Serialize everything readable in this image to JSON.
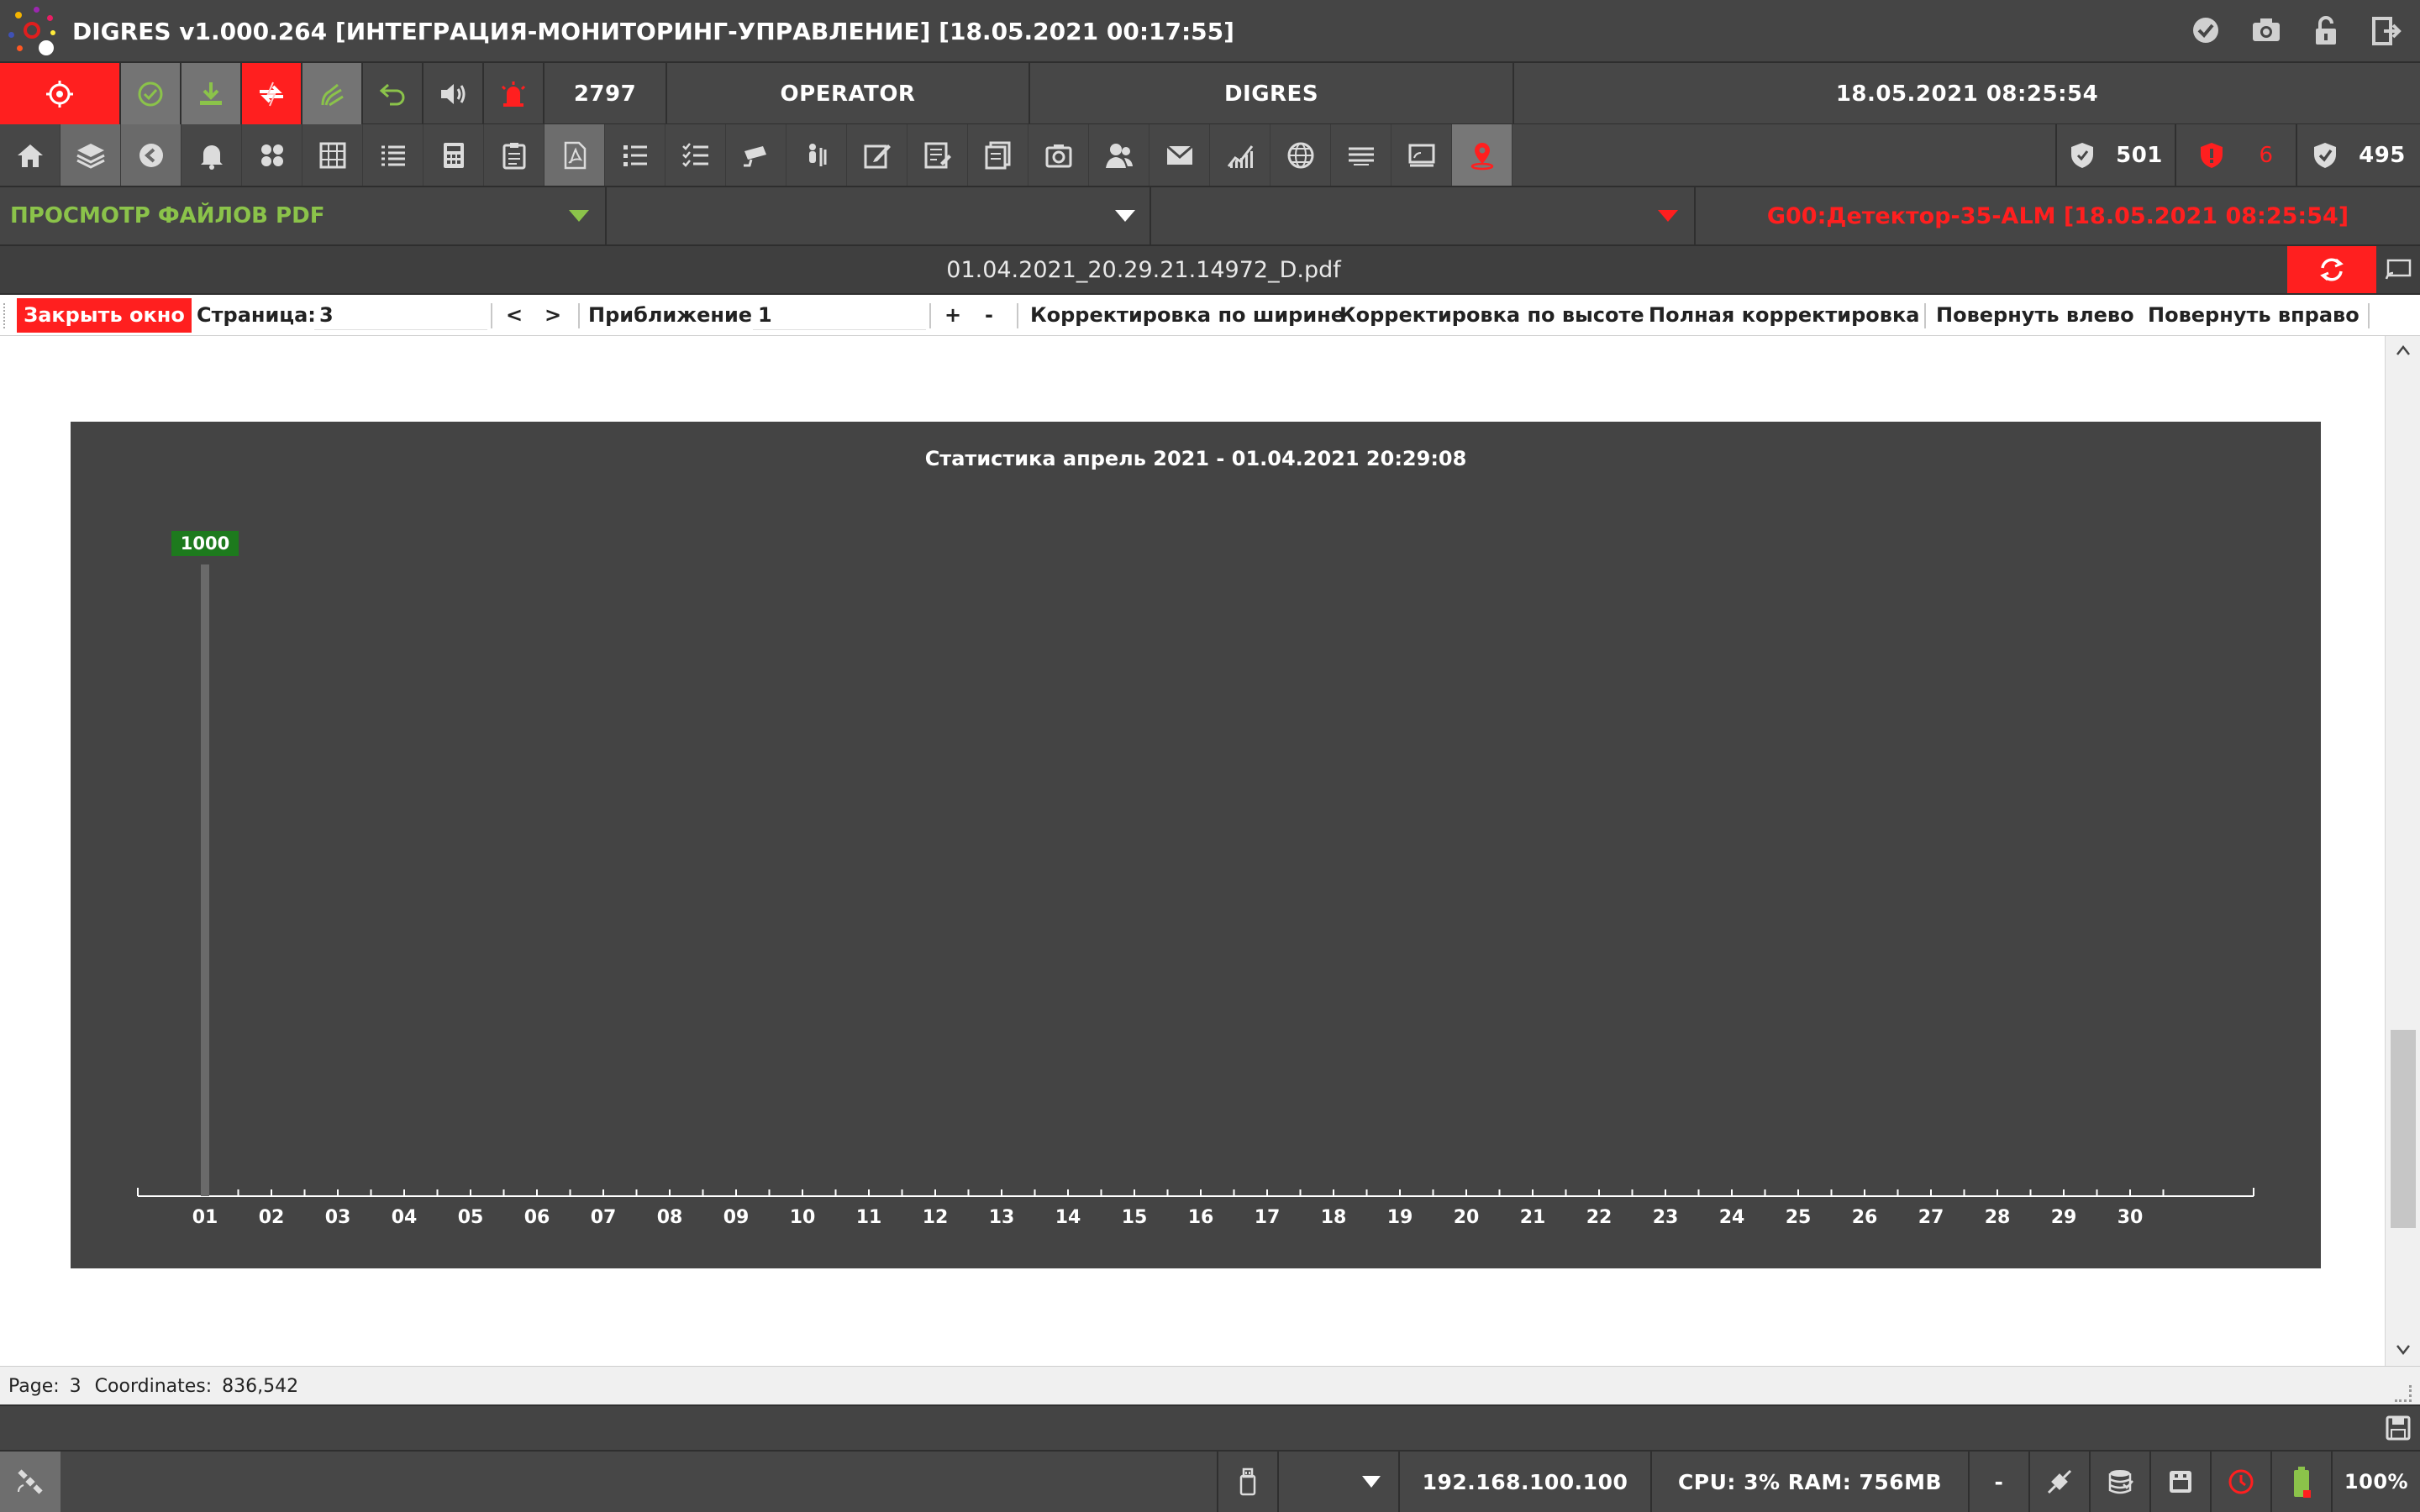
{
  "window": {
    "title": "DIGRES v1.000.264 [ИНТЕГРАЦИЯ-МОНИТОРИНГ-УПРАВЛЕНИЕ] [18.05.2021 00:17:55]",
    "title_icons": [
      "check-circle-icon",
      "camera-icon",
      "lock-icon",
      "exit-icon"
    ]
  },
  "header": {
    "counter": "2797",
    "user": "OPERATOR",
    "system": "DIGRES",
    "datetime": "18.05.2021 08:25:54"
  },
  "toolbar_icons": [
    "home-icon",
    "layers-icon",
    "back-icon",
    "bell-icon",
    "apps-icon",
    "grid-icon",
    "list-icon",
    "calculator-icon",
    "clipboard-icon",
    "pdf-icon",
    "list-bullets-icon",
    "checklist-icon",
    "camera-cctv-icon",
    "people-icon",
    "edit-icon",
    "report-icon",
    "documents-icon",
    "photo-icon",
    "users-icon",
    "mail-icon",
    "chart-icon",
    "globe-icon",
    "lines-icon",
    "cast-icon",
    "map-pin-icon"
  ],
  "badges": {
    "shield_ok": "501",
    "shield_alarm": "6",
    "shield_check": "495"
  },
  "mode": {
    "title": "ПРОСМОТР ФАЙЛОВ PDF",
    "alarm_text": "G00:Детектор-35-ALM [18.05.2021 08:25:54]"
  },
  "file": {
    "name": "01.04.2021_20.29.21.14972_D.pdf"
  },
  "pdfbar": {
    "close": "Закрыть окно",
    "page_label": "Страница:",
    "page_value": "3",
    "prev": "<",
    "next": ">",
    "zoom_label": "Приближение:",
    "zoom_value": "1",
    "zoom_in": "+",
    "zoom_out": "-",
    "fit_width": "Корректировка по ширине",
    "fit_height": "Корректировка по высоте",
    "fit_full": "Полная корректировка",
    "rotate_left": "Повернуть влево",
    "rotate_right": "Повернуть вправо"
  },
  "status": {
    "page_label": "Page:",
    "page": "3",
    "coords_label": "Coordinates:",
    "coords": "836,542"
  },
  "bottom": {
    "ip": "192.168.100.100",
    "cpu_ram": "CPU: 3% RAM: 756MB",
    "dash": "-",
    "zoom": "100%"
  },
  "colors": {
    "alarm_red": "#ff1f1f",
    "accent_green": "#8bc34a",
    "bar_green": "#1d7a1d"
  },
  "chart_data": {
    "type": "bar",
    "title": "Статистика  апрель 2021  -  01.04.2021  20:29:08",
    "categories": [
      "01",
      "02",
      "03",
      "04",
      "05",
      "06",
      "07",
      "08",
      "09",
      "10",
      "11",
      "12",
      "13",
      "14",
      "15",
      "16",
      "17",
      "18",
      "19",
      "20",
      "21",
      "22",
      "23",
      "24",
      "25",
      "26",
      "27",
      "28",
      "29",
      "30"
    ],
    "values": [
      1000,
      0,
      0,
      0,
      0,
      0,
      0,
      0,
      0,
      0,
      0,
      0,
      0,
      0,
      0,
      0,
      0,
      0,
      0,
      0,
      0,
      0,
      0,
      0,
      0,
      0,
      0,
      0,
      0,
      0
    ],
    "ylim": [
      0,
      1000
    ],
    "grid": false
  }
}
